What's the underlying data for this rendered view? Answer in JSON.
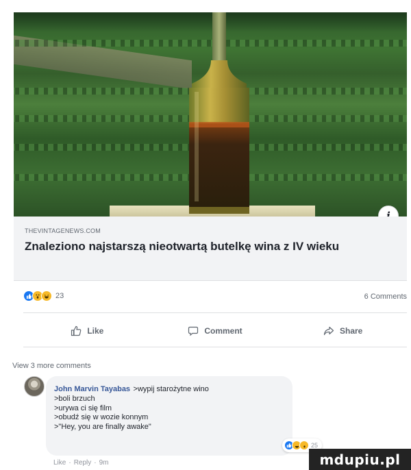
{
  "link_preview": {
    "domain": "THEVINTAGENEWS.COM",
    "title": "Znaleziono najstarszą nieotwartą butelkę wina z IV wieku",
    "info_glyph": "i"
  },
  "reactions": {
    "types": [
      "like-reaction-icon",
      "wow-reaction-icon",
      "haha-reaction-icon"
    ],
    "count": "23",
    "comments_label": "6 Comments"
  },
  "actions": {
    "like": "Like",
    "comment": "Comment",
    "share": "Share"
  },
  "comments_section": {
    "view_more": "View 3 more comments",
    "comment": {
      "author": "John Marvin Tayabas",
      "lines": [
        ">wypij starożytne wino",
        ">boli brzuch",
        ">urywa ci się film",
        ">obudź się w wozie konnym",
        ">\"Hey, you are finally awake\""
      ],
      "reaction_count": "25",
      "like_label": "Like",
      "reply_label": "Reply",
      "time": "9m",
      "separator": "·"
    }
  },
  "watermark": "mdupiu.pl",
  "colors": {
    "link_blue": "#385898",
    "like_blue": "#1877f2",
    "reaction_yellow": "#f7b928",
    "meta_grey": "#606770",
    "card_bg": "#f2f3f5"
  }
}
